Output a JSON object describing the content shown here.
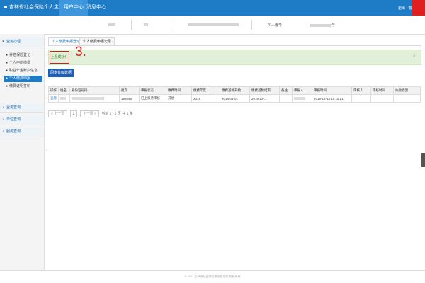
{
  "header": {
    "title": "吉林省社会保险个人主页",
    "nav": [
      "用户中心",
      "消息中心"
    ],
    "right_text": "退出 · 帮助"
  },
  "info": {
    "id_label": "个人编号：",
    "suffix": "号"
  },
  "sidebar": {
    "sections": [
      {
        "label": "业务办理"
      },
      {
        "label": "业务查询"
      },
      {
        "label": "单位查询"
      },
      {
        "label": "服务查询"
      }
    ],
    "items": [
      {
        "label": "养老保险登记"
      },
      {
        "label": "个人中断缴费"
      },
      {
        "label": "职业年金账户信息"
      },
      {
        "label": "个人缴费申报"
      },
      {
        "label": "缴费证明打印"
      }
    ]
  },
  "tabs": [
    {
      "label": "个人缴费申报登记"
    },
    {
      "label": "个人缴费申报记录"
    }
  ],
  "alert": {
    "button_label": "上报成功！",
    "step_marker": "3.",
    "close": "×"
  },
  "sync_button": "同步省级数据",
  "table": {
    "headers": [
      "操作",
      "姓名",
      "身份证号码",
      "批次",
      "申报状态",
      "缴费时间",
      "缴费年度",
      "缴费基数开始",
      "缴费基数结束",
      "备注",
      "申报人",
      "申报时间",
      "审核人",
      "审核时间",
      "失败原因"
    ],
    "rows": [
      {
        "action": "查看",
        "batch": "192045",
        "status": "已上报待审核",
        "type": "其他",
        "year": "2018",
        "start": "2018-01-01",
        "end": "2018-12-...",
        "time": "2018-12-13 15:15:51"
      }
    ]
  },
  "pager": {
    "prev": "« 上一页",
    "page": "1",
    "next": "下一页 »",
    "summary": "当前 1 / 1 页 共 1 条"
  },
  "footer": "© 2014 吉林省社会保险事业管理局 版权所有"
}
